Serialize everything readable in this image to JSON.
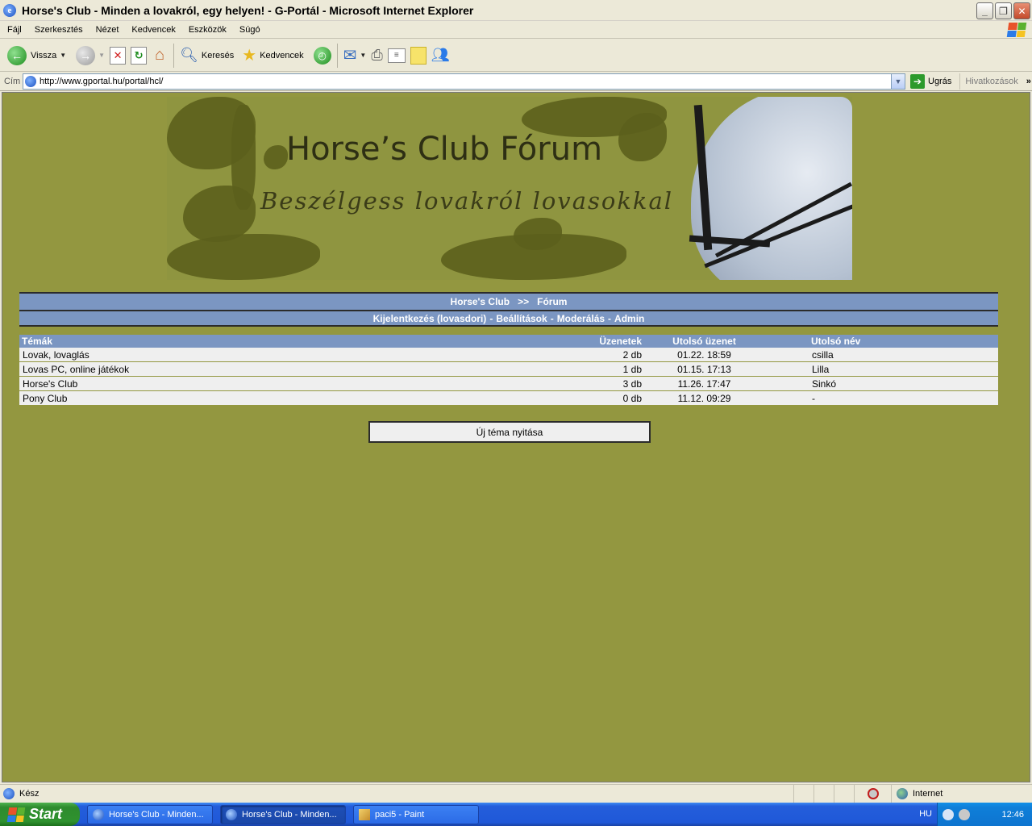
{
  "window": {
    "title": "Horse's Club - Minden a lovakról, egy helyen! - G-Portál - Microsoft Internet Explorer"
  },
  "menu": [
    "Fájl",
    "Szerkesztés",
    "Nézet",
    "Kedvencek",
    "Eszközök",
    "Súgó"
  ],
  "toolbar": {
    "back_label": "Vissza",
    "search_label": "Keresés",
    "favorites_label": "Kedvencek"
  },
  "address": {
    "label": "Cím",
    "url": "http://www.gportal.hu/portal/hcl/",
    "go_label": "Ugrás",
    "links_label": "Hivatkozások",
    "links_chevron": "»"
  },
  "banner": {
    "title": "Horse’s Club Fórum",
    "subtitle": "Beszélgess lovakról lovasokkal!"
  },
  "nav": {
    "breadcrumb_home": "Horse's Club",
    "breadcrumb_sep": ">>",
    "breadcrumb_current": "Fórum",
    "links": [
      "Kijelentkezés (lovasdori)",
      "Beállítások",
      "Moderálás",
      "Admin"
    ],
    "link_sep": "-"
  },
  "forum": {
    "headers": {
      "topics": "Témák",
      "messages": "Üzenetek",
      "last_message": "Utolsó üzenet",
      "last_name": "Utolsó név"
    },
    "rows": [
      {
        "topic": "Lovak, lovaglás",
        "messages": "2 db",
        "last_message": "01.22. 18:59",
        "last_name": "csilla"
      },
      {
        "topic": "Lovas PC, online játékok",
        "messages": "1 db",
        "last_message": "01.15. 17:13",
        "last_name": "Lilla"
      },
      {
        "topic": "Horse's Club",
        "messages": "3 db",
        "last_message": "11.26. 17:47",
        "last_name": "Sinkó"
      },
      {
        "topic": "Pony Club",
        "messages": "0 db",
        "last_message": "11.12. 09:29",
        "last_name": "-"
      }
    ],
    "new_topic_label": "Új téma nyitása"
  },
  "status": {
    "text": "Kész",
    "zone": "Internet"
  },
  "taskbar": {
    "start_label": "Start",
    "tasks": [
      {
        "label": "Horse's Club - Minden...",
        "active": false
      },
      {
        "label": "Horse's Club - Minden...",
        "active": true
      },
      {
        "label": "paci5 - Paint",
        "active": false
      }
    ],
    "lang": "HU",
    "clock": "12:46"
  },
  "colors": {
    "page_bg": "#939740",
    "header_blue": "#7b96c2",
    "row_bg": "#efefef"
  }
}
